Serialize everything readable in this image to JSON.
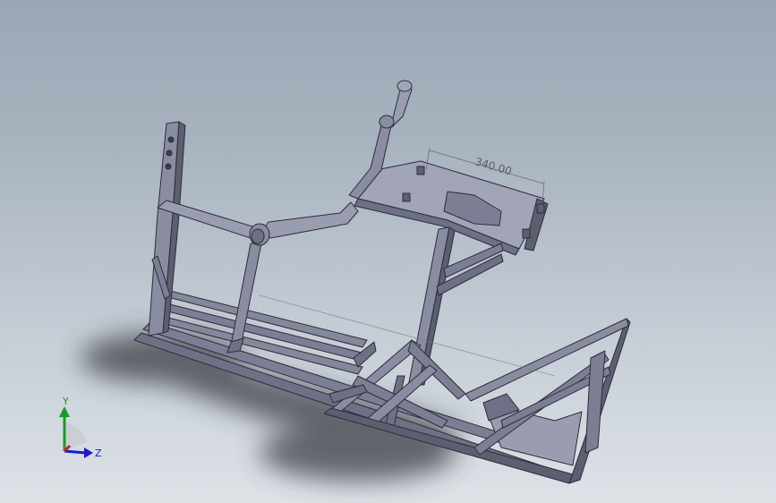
{
  "model": {
    "name": "welded-tube-frame",
    "dimension_label": "340.00"
  },
  "triad": {
    "y_label": "Y",
    "z_label": "Z",
    "colors": {
      "y": "#1a9a2a",
      "z": "#1a1ad0",
      "x": "#c02020"
    }
  },
  "colors": {
    "tube": "#7c7f94",
    "tube_light": "#9a9db0",
    "tube_dark": "#4a4c5c",
    "edge": "#2c2d38",
    "plate": "#8a8da2",
    "shadow": "#3a3c44"
  }
}
